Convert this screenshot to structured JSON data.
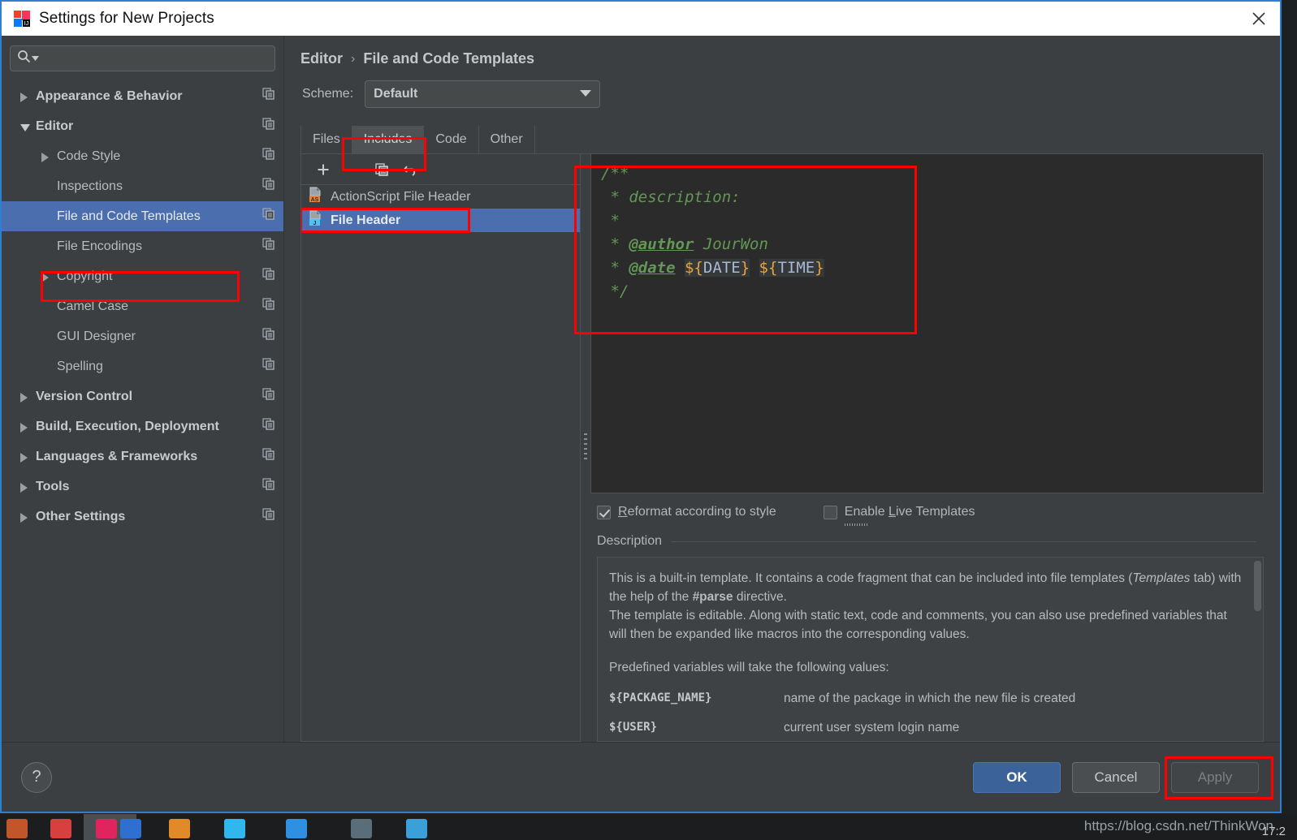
{
  "window": {
    "title": "Settings for New Projects",
    "app_icon": "intellij-idea-icon",
    "close_icon": "close-icon"
  },
  "sidebar": {
    "search": {
      "placeholder": "",
      "value": "",
      "icon": "search-icon",
      "dropdown_icon": "chevron-down-icon"
    },
    "items": [
      {
        "label": "Appearance & Behavior",
        "level": 0,
        "expandable": true,
        "expanded": false,
        "selected": false,
        "bold": true
      },
      {
        "label": "Editor",
        "level": 0,
        "expandable": true,
        "expanded": true,
        "selected": false,
        "bold": true
      },
      {
        "label": "Code Style",
        "level": 1,
        "expandable": true,
        "expanded": false,
        "selected": false,
        "bold": false
      },
      {
        "label": "Inspections",
        "level": 1,
        "expandable": false,
        "expanded": false,
        "selected": false,
        "bold": false
      },
      {
        "label": "File and Code Templates",
        "level": 1,
        "expandable": false,
        "expanded": false,
        "selected": true,
        "bold": false
      },
      {
        "label": "File Encodings",
        "level": 1,
        "expandable": false,
        "expanded": false,
        "selected": false,
        "bold": false
      },
      {
        "label": "Copyright",
        "level": 1,
        "expandable": true,
        "expanded": false,
        "selected": false,
        "bold": false
      },
      {
        "label": "Camel Case",
        "level": 1,
        "expandable": false,
        "expanded": false,
        "selected": false,
        "bold": false
      },
      {
        "label": "GUI Designer",
        "level": 1,
        "expandable": false,
        "expanded": false,
        "selected": false,
        "bold": false
      },
      {
        "label": "Spelling",
        "level": 1,
        "expandable": false,
        "expanded": false,
        "selected": false,
        "bold": false
      },
      {
        "label": "Version Control",
        "level": 0,
        "expandable": true,
        "expanded": false,
        "selected": false,
        "bold": true
      },
      {
        "label": "Build, Execution, Deployment",
        "level": 0,
        "expandable": true,
        "expanded": false,
        "selected": false,
        "bold": true
      },
      {
        "label": "Languages & Frameworks",
        "level": 0,
        "expandable": true,
        "expanded": false,
        "selected": false,
        "bold": true
      },
      {
        "label": "Tools",
        "level": 0,
        "expandable": true,
        "expanded": false,
        "selected": false,
        "bold": true
      },
      {
        "label": "Other Settings",
        "level": 0,
        "expandable": true,
        "expanded": false,
        "selected": false,
        "bold": true
      }
    ]
  },
  "breadcrumb": {
    "parent": "Editor",
    "separator": "›",
    "current": "File and Code Templates"
  },
  "scheme": {
    "label": "Scheme:",
    "value": "Default",
    "dropdown_icon": "chevron-down-icon"
  },
  "tabs": [
    {
      "label": "Files",
      "active": false
    },
    {
      "label": "Includes",
      "active": true
    },
    {
      "label": "Code",
      "active": false
    },
    {
      "label": "Other",
      "active": false
    }
  ],
  "list_toolbar": [
    {
      "name": "add-template-button",
      "icon": "plus-icon"
    },
    {
      "name": "remove-template-button",
      "icon": "minus-icon"
    },
    {
      "name": "copy-template-button",
      "icon": "copy-icon"
    },
    {
      "name": "reset-template-button",
      "icon": "undo-icon"
    }
  ],
  "templates": [
    {
      "label": "ActionScript File Header",
      "icon": "actionscript-file-icon",
      "badge": "AS",
      "selected": false
    },
    {
      "label": "File Header",
      "icon": "java-file-icon",
      "badge": "J",
      "selected": true
    }
  ],
  "editor": {
    "lines": [
      "/**",
      " * description:",
      " *",
      " * @author JourWon",
      " * @date ${DATE} ${TIME}",
      " */"
    ],
    "author_tag": "@author",
    "author_value": "JourWon",
    "date_tag": "@date",
    "date_var": "${DATE}",
    "time_var": "${TIME}"
  },
  "checkboxes": [
    {
      "label": "Reformat according to style",
      "checked": true,
      "mnemonic": "R"
    },
    {
      "label": "Enable Live Templates",
      "checked": false,
      "mnemonic": "L"
    }
  ],
  "description": {
    "title": "Description",
    "paragraph1_a": "This is a built-in template. It contains a code fragment that can be included into file templates (",
    "paragraph1_italic": "Templates",
    "paragraph1_b": " tab) with the help of the ",
    "paragraph1_bold": "#parse",
    "paragraph1_c": " directive.",
    "paragraph2": "The template is editable. Along with static text, code and comments, you can also use predefined variables that will then be expanded like macros into the corresponding values.",
    "paragraph3": "Predefined variables will take the following values:",
    "variables": [
      {
        "name": "${PACKAGE_NAME}",
        "desc": "name of the package in which the new file is created"
      },
      {
        "name": "${USER}",
        "desc": "current user system login name"
      }
    ]
  },
  "footer": {
    "help_label": "?",
    "ok_label": "OK",
    "cancel_label": "Cancel",
    "apply_label": "Apply",
    "apply_disabled": true
  },
  "watermark": "https://blog.csdn.net/ThinkWon",
  "clock": "17:2",
  "colors": {
    "dialog_bg": "#3c3f41",
    "selection_blue": "#4b6eaf",
    "annotation_red": "#ff0000",
    "editor_bg": "#2b2b2b",
    "comment_green": "#629755",
    "variable_brace_orange": "#e8a33d",
    "variable_inner_blue": "#a9b7d6",
    "primary_button_blue": "#3c6399",
    "window_border_blue": "#2f7fd0"
  }
}
